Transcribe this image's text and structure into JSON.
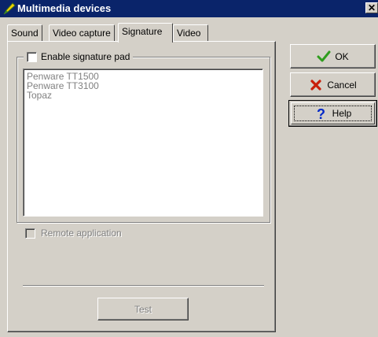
{
  "window": {
    "title": "Multimedia devices",
    "title_icon": "pen-icon",
    "close_label": "✕"
  },
  "tabs": [
    {
      "label": "Sound",
      "active": false
    },
    {
      "label": "Video capture",
      "active": false
    },
    {
      "label": "Signature",
      "active": true
    },
    {
      "label": "Video",
      "active": false
    }
  ],
  "signature": {
    "enable_label": "Enable signature pad",
    "enable_checked": false,
    "devices": [
      "Penware TT1500",
      "Penware TT3100",
      "Topaz"
    ],
    "remote_label": "Remote application",
    "remote_checked": false,
    "test_label": "Test"
  },
  "buttons": {
    "ok_label": "OK",
    "cancel_label": "Cancel",
    "help_label": "Help"
  },
  "colors": {
    "titlebar": "#0a246a",
    "ok_check": "#2f9d1e",
    "cancel_x": "#c81e0a",
    "help_q": "#0028c8"
  }
}
